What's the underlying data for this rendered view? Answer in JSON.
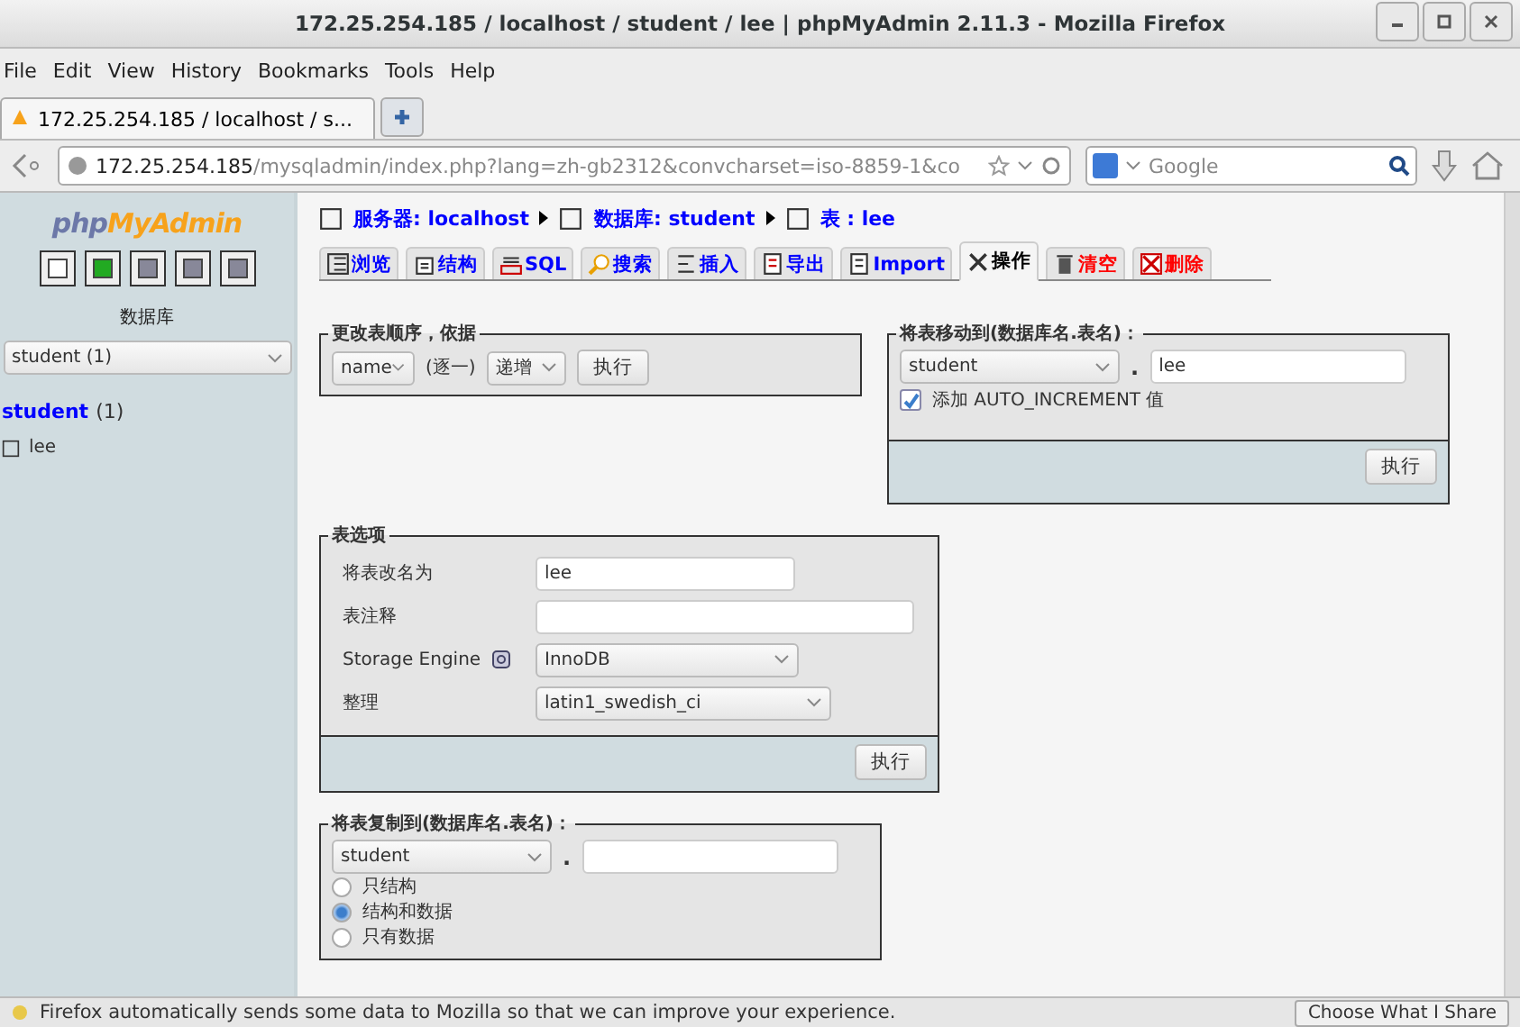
{
  "window": {
    "title": "172.25.254.185 / localhost / student / lee | phpMyAdmin 2.11.3 - Mozilla Firefox"
  },
  "menu": [
    "File",
    "Edit",
    "View",
    "History",
    "Bookmarks",
    "Tools",
    "Help"
  ],
  "browser_tab": {
    "title": "172.25.254.185 / localhost / s..."
  },
  "address_bar": {
    "host": "172.25.254.185",
    "path": "/mysqladmin/index.php?lang=zh-gb2312&convcharset=iso-8859-1&co"
  },
  "search": {
    "placeholder": "Google"
  },
  "sidebar": {
    "logo": {
      "prefix": "php",
      "name": "MyAdmin"
    },
    "database_label": "数据库",
    "database_select": "student (1)",
    "database_link": {
      "name": "student",
      "count": "(1)"
    },
    "tables": [
      "lee"
    ]
  },
  "breadcrumb": [
    {
      "label": "服务器: localhost"
    },
    {
      "label": "数据库: student"
    },
    {
      "label": "表 : lee"
    }
  ],
  "tabs": [
    {
      "label": "浏览",
      "kind": "normal",
      "selected": false
    },
    {
      "label": "结构",
      "kind": "normal",
      "selected": false
    },
    {
      "label": "SQL",
      "kind": "normal",
      "selected": false
    },
    {
      "label": "搜索",
      "kind": "normal",
      "selected": false
    },
    {
      "label": "插入",
      "kind": "normal",
      "selected": false
    },
    {
      "label": "导出",
      "kind": "normal",
      "selected": false
    },
    {
      "label": "Import",
      "kind": "normal",
      "selected": false
    },
    {
      "label": "操作",
      "kind": "normal",
      "selected": true
    },
    {
      "label": "清空",
      "kind": "danger",
      "selected": false
    },
    {
      "label": "删除",
      "kind": "danger",
      "selected": false
    }
  ],
  "reorder": {
    "legend": "更改表顺序，依据",
    "field": "name",
    "text": "(逐一)",
    "order": "递增",
    "button": "执行"
  },
  "move": {
    "legend": "将表移动到(数据库名.表名)：",
    "database": "student",
    "separator": ".",
    "table": "lee",
    "checkbox": {
      "label": "添加 AUTO_INCREMENT 值",
      "checked": true
    },
    "button": "执行"
  },
  "options": {
    "legend": "表选项",
    "rows": [
      {
        "kind": "input",
        "label": "将表改名为",
        "value": "lee"
      },
      {
        "kind": "input",
        "label": "表注释"
      },
      {
        "kind": "select",
        "label": "Storage Engine",
        "help": true,
        "value": "InnoDB"
      },
      {
        "kind": "select",
        "label": "整理",
        "value": "latin1_swedish_ci"
      }
    ],
    "button": "执行"
  },
  "copy": {
    "legend": "将表复制到(数据库名.表名)：",
    "database": "student",
    "separator": ".",
    "radios": [
      {
        "label": "只结构",
        "selected": false
      },
      {
        "label": "结构和数据",
        "selected": true
      },
      {
        "label": "只有数据",
        "selected": false
      }
    ]
  },
  "notification": {
    "text": "Firefox automatically sends some data to Mozilla so that we can improve your experience.",
    "button": "Choose What I Share"
  }
}
